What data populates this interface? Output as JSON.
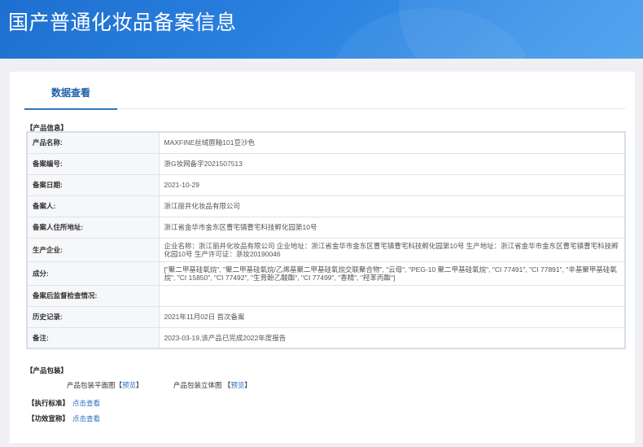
{
  "header": {
    "title": "国产普通化妆品备案信息"
  },
  "tabs": [
    {
      "label": "数据查看"
    }
  ],
  "product_info": {
    "section_label": "【产品信息】",
    "rows": [
      {
        "key": "产品名称:",
        "value": "MAXFINE丝绒唇釉101豆沙色"
      },
      {
        "key": "备案编号:",
        "value": "浙G妆网备字2021507513"
      },
      {
        "key": "备案日期:",
        "value": "2021-10-29"
      },
      {
        "key": "备案人:",
        "value": "浙江丽井化妆品有限公司"
      },
      {
        "key": "备案人住所地址:",
        "value": "浙江省金华市金东区曹宅镇曹宅科技孵化园第10号"
      },
      {
        "key": "生产企业:",
        "value": "企业名称：浙江丽井化妆品有限公司 企业地址：浙江省金华市金东区曹宅镇曹宅科技孵化园第10号 生产地址：浙江省金华市金东区曹宅镇曹宅科技孵化园10号 生产许可证：浙妆20190046"
      },
      {
        "key": "成分:",
        "value": "[\"聚二甲基硅氧烷\", \"聚二甲基硅氧烷/乙烯基聚二甲基硅氧烷交联聚合物\", \"云母\", \"PEG-10 聚二甲基硅氧烷\", \"CI 77491\", \"CI 77891\", \"辛基聚甲基硅氧烷\", \"CI 15850\", \"CI 77492\", \"生育酚乙酸酯\", \"CI 77499\", \"香精\", \"羟苯丙酯\"]"
      },
      {
        "key": "备案后监督检查情况:",
        "value": ""
      },
      {
        "key": "历史记录:",
        "value": "2021年11月02日 首次备案"
      },
      {
        "key": "备注:",
        "value": "2023-03-19,该产品已完成2022年度报告"
      }
    ]
  },
  "packaging": {
    "section_label": "【产品包装】",
    "flat_label": "产品包装平面图",
    "solid_label": "产品包装立体图",
    "bracket_open": "【",
    "bracket_close": "】",
    "preview_label": "预览"
  },
  "standard": {
    "label": "【执行标准】",
    "link": "点击查看"
  },
  "efficacy": {
    "label": "【功效宣称】",
    "link": "点击查看"
  }
}
